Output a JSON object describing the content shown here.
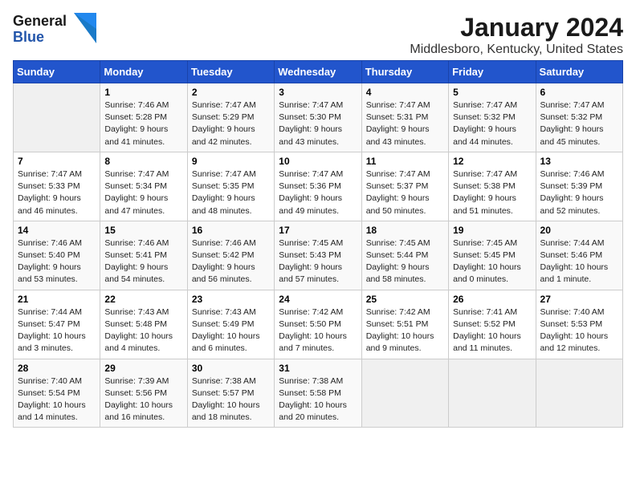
{
  "header": {
    "logo_line1": "General",
    "logo_line2": "Blue",
    "title": "January 2024",
    "subtitle": "Middlesboro, Kentucky, United States"
  },
  "days_of_week": [
    "Sunday",
    "Monday",
    "Tuesday",
    "Wednesday",
    "Thursday",
    "Friday",
    "Saturday"
  ],
  "weeks": [
    [
      {
        "num": "",
        "info": ""
      },
      {
        "num": "1",
        "info": "Sunrise: 7:46 AM\nSunset: 5:28 PM\nDaylight: 9 hours\nand 41 minutes."
      },
      {
        "num": "2",
        "info": "Sunrise: 7:47 AM\nSunset: 5:29 PM\nDaylight: 9 hours\nand 42 minutes."
      },
      {
        "num": "3",
        "info": "Sunrise: 7:47 AM\nSunset: 5:30 PM\nDaylight: 9 hours\nand 43 minutes."
      },
      {
        "num": "4",
        "info": "Sunrise: 7:47 AM\nSunset: 5:31 PM\nDaylight: 9 hours\nand 43 minutes."
      },
      {
        "num": "5",
        "info": "Sunrise: 7:47 AM\nSunset: 5:32 PM\nDaylight: 9 hours\nand 44 minutes."
      },
      {
        "num": "6",
        "info": "Sunrise: 7:47 AM\nSunset: 5:32 PM\nDaylight: 9 hours\nand 45 minutes."
      }
    ],
    [
      {
        "num": "7",
        "info": "Sunrise: 7:47 AM\nSunset: 5:33 PM\nDaylight: 9 hours\nand 46 minutes."
      },
      {
        "num": "8",
        "info": "Sunrise: 7:47 AM\nSunset: 5:34 PM\nDaylight: 9 hours\nand 47 minutes."
      },
      {
        "num": "9",
        "info": "Sunrise: 7:47 AM\nSunset: 5:35 PM\nDaylight: 9 hours\nand 48 minutes."
      },
      {
        "num": "10",
        "info": "Sunrise: 7:47 AM\nSunset: 5:36 PM\nDaylight: 9 hours\nand 49 minutes."
      },
      {
        "num": "11",
        "info": "Sunrise: 7:47 AM\nSunset: 5:37 PM\nDaylight: 9 hours\nand 50 minutes."
      },
      {
        "num": "12",
        "info": "Sunrise: 7:47 AM\nSunset: 5:38 PM\nDaylight: 9 hours\nand 51 minutes."
      },
      {
        "num": "13",
        "info": "Sunrise: 7:46 AM\nSunset: 5:39 PM\nDaylight: 9 hours\nand 52 minutes."
      }
    ],
    [
      {
        "num": "14",
        "info": "Sunrise: 7:46 AM\nSunset: 5:40 PM\nDaylight: 9 hours\nand 53 minutes."
      },
      {
        "num": "15",
        "info": "Sunrise: 7:46 AM\nSunset: 5:41 PM\nDaylight: 9 hours\nand 54 minutes."
      },
      {
        "num": "16",
        "info": "Sunrise: 7:46 AM\nSunset: 5:42 PM\nDaylight: 9 hours\nand 56 minutes."
      },
      {
        "num": "17",
        "info": "Sunrise: 7:45 AM\nSunset: 5:43 PM\nDaylight: 9 hours\nand 57 minutes."
      },
      {
        "num": "18",
        "info": "Sunrise: 7:45 AM\nSunset: 5:44 PM\nDaylight: 9 hours\nand 58 minutes."
      },
      {
        "num": "19",
        "info": "Sunrise: 7:45 AM\nSunset: 5:45 PM\nDaylight: 10 hours\nand 0 minutes."
      },
      {
        "num": "20",
        "info": "Sunrise: 7:44 AM\nSunset: 5:46 PM\nDaylight: 10 hours\nand 1 minute."
      }
    ],
    [
      {
        "num": "21",
        "info": "Sunrise: 7:44 AM\nSunset: 5:47 PM\nDaylight: 10 hours\nand 3 minutes."
      },
      {
        "num": "22",
        "info": "Sunrise: 7:43 AM\nSunset: 5:48 PM\nDaylight: 10 hours\nand 4 minutes."
      },
      {
        "num": "23",
        "info": "Sunrise: 7:43 AM\nSunset: 5:49 PM\nDaylight: 10 hours\nand 6 minutes."
      },
      {
        "num": "24",
        "info": "Sunrise: 7:42 AM\nSunset: 5:50 PM\nDaylight: 10 hours\nand 7 minutes."
      },
      {
        "num": "25",
        "info": "Sunrise: 7:42 AM\nSunset: 5:51 PM\nDaylight: 10 hours\nand 9 minutes."
      },
      {
        "num": "26",
        "info": "Sunrise: 7:41 AM\nSunset: 5:52 PM\nDaylight: 10 hours\nand 11 minutes."
      },
      {
        "num": "27",
        "info": "Sunrise: 7:40 AM\nSunset: 5:53 PM\nDaylight: 10 hours\nand 12 minutes."
      }
    ],
    [
      {
        "num": "28",
        "info": "Sunrise: 7:40 AM\nSunset: 5:54 PM\nDaylight: 10 hours\nand 14 minutes."
      },
      {
        "num": "29",
        "info": "Sunrise: 7:39 AM\nSunset: 5:56 PM\nDaylight: 10 hours\nand 16 minutes."
      },
      {
        "num": "30",
        "info": "Sunrise: 7:38 AM\nSunset: 5:57 PM\nDaylight: 10 hours\nand 18 minutes."
      },
      {
        "num": "31",
        "info": "Sunrise: 7:38 AM\nSunset: 5:58 PM\nDaylight: 10 hours\nand 20 minutes."
      },
      {
        "num": "",
        "info": ""
      },
      {
        "num": "",
        "info": ""
      },
      {
        "num": "",
        "info": ""
      }
    ]
  ]
}
